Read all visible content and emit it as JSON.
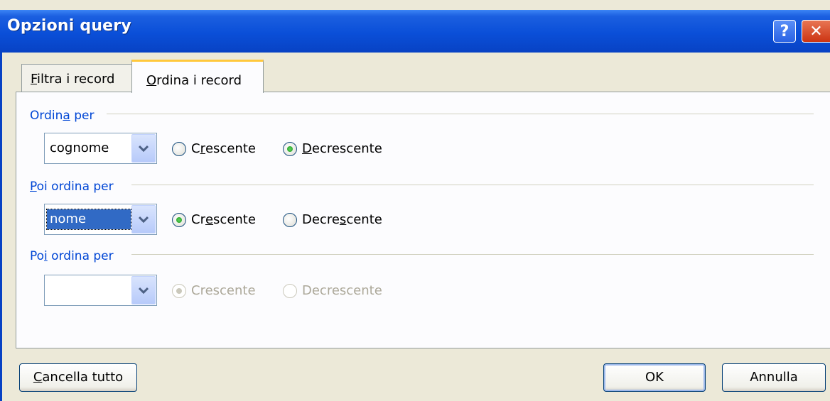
{
  "window": {
    "title": "Opzioni query"
  },
  "titlebar": {
    "help_glyph": "?",
    "close_glyph": "✕"
  },
  "tabs": [
    {
      "label_pre": "",
      "label_ul": "F",
      "label_post": "iltra i record",
      "active": false
    },
    {
      "label_pre": "",
      "label_ul": "O",
      "label_post": "rdina i record",
      "active": true
    }
  ],
  "sort_groups": [
    {
      "label_pre": "Ordin",
      "label_ul": "a",
      "label_post": " per",
      "field_value": "cognome",
      "field_selected": false,
      "asc": {
        "pre": "C",
        "ul": "r",
        "post": "escente"
      },
      "desc": {
        "pre": "",
        "ul": "D",
        "post": "ecrescente"
      },
      "order": "desc",
      "enabled": true
    },
    {
      "label_pre": "",
      "label_ul": "P",
      "label_post": "oi ordina per",
      "field_value": "nome",
      "field_selected": true,
      "asc": {
        "pre": "Cr",
        "ul": "e",
        "post": "scente"
      },
      "desc": {
        "pre": "Decre",
        "ul": "s",
        "post": "cente"
      },
      "order": "asc",
      "enabled": true
    },
    {
      "label_pre": "Po",
      "label_ul": "i",
      "label_post": " ordina per",
      "field_value": "",
      "field_selected": false,
      "asc": {
        "pre": "Crescente",
        "ul": "",
        "post": ""
      },
      "desc": {
        "pre": "Decrescente",
        "ul": "",
        "post": ""
      },
      "order": "asc",
      "enabled": false
    }
  ],
  "buttons": {
    "clear_all": {
      "pre": "",
      "ul": "C",
      "post": "ancella tutto"
    },
    "ok": "OK",
    "cancel": "Annulla"
  },
  "colors": {
    "title_bar": "#0842c4",
    "group_label": "#0046d5",
    "dialog_bg": "#ece9d8",
    "tab_accent": "#ffc83c"
  }
}
